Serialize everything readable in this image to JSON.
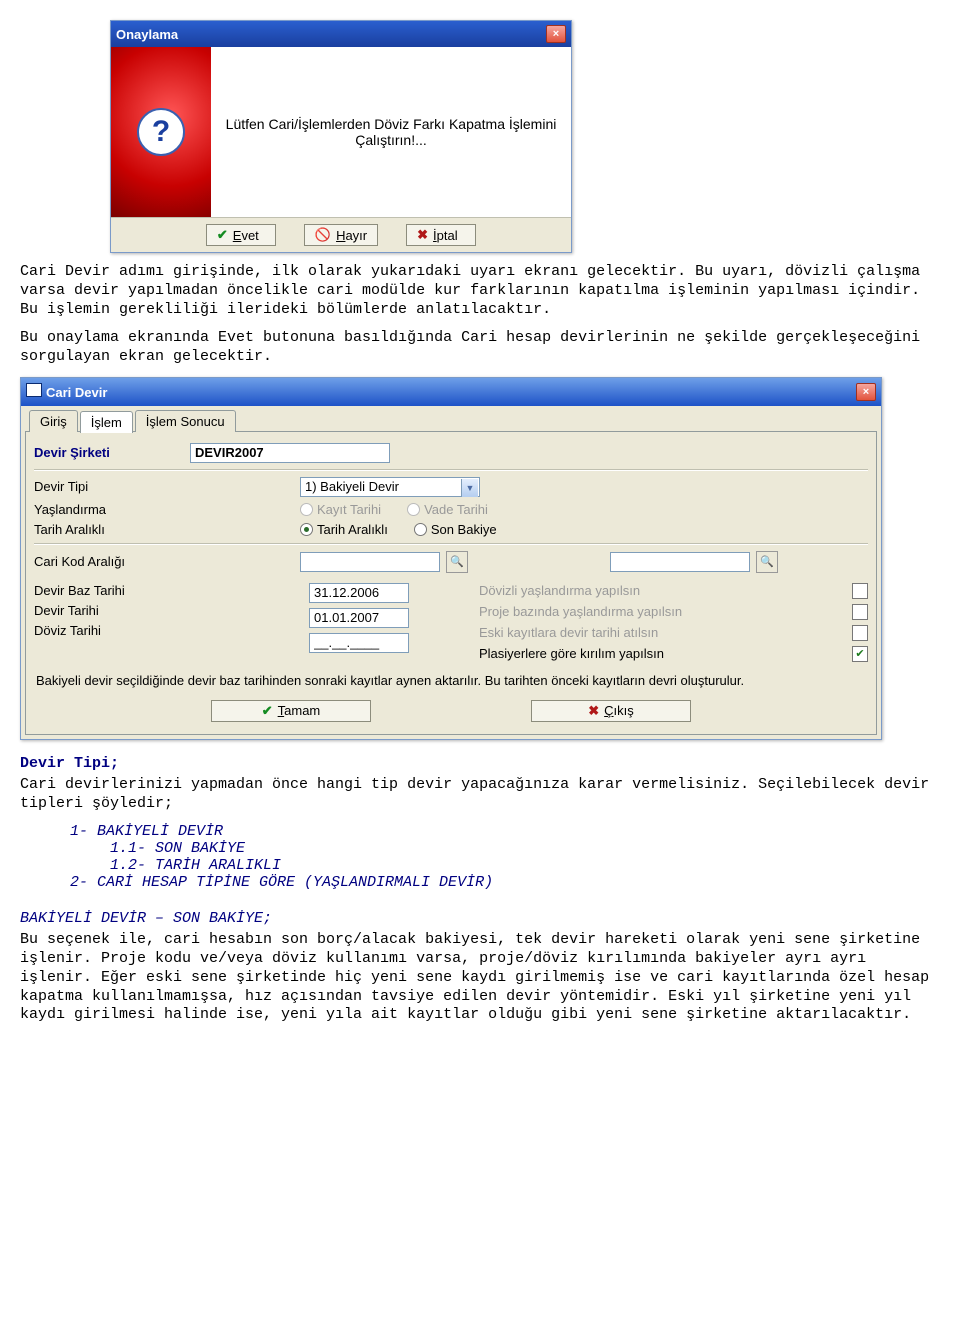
{
  "confirm": {
    "title": "Onaylama",
    "message": "Lütfen Cari/İşlemlerden Döviz Farkı Kapatma İşlemini Çalıştırın!...",
    "btn_yes": "Evet",
    "btn_no": "Hayır",
    "btn_cancel": "İptal"
  },
  "para1": "Cari Devir adımı girişinde, ilk olarak yukarıdaki uyarı ekranı gelecektir. Bu uyarı, dövizli çalışma varsa devir yapılmadan öncelikle cari modülde kur farklarının kapatılma işleminin yapılması içindir. Bu işlemin gerekliliği ilerideki bölümlerde anlatılacaktır.",
  "para2": "Bu onaylama ekranında Evet butonuna basıldığında Cari hesap devirlerinin ne şekilde gerçekleşeceğini sorgulayan ekran gelecektir.",
  "devir": {
    "title": "Cari Devir",
    "tabs": {
      "t1": "Giriş",
      "t2": "İşlem",
      "t3": "İşlem Sonucu"
    },
    "sirketi_label": "Devir Şirketi",
    "sirketi_value": "DEVIR2007",
    "tip_label": "Devir Tipi",
    "tip_value": "1) Bakiyeli Devir",
    "yas_label": "Yaşlandırma",
    "yas_r1": "Kayıt Tarihi",
    "yas_r2": "Vade Tarihi",
    "aralik_label": "Tarih Aralıklı",
    "aralik_r1": "Tarih Aralıklı",
    "aralik_r2": "Son Bakiye",
    "kod_label": "Cari Kod Aralığı",
    "baz_label": "Devir Baz Tarihi",
    "baz_value": "31.12.2006",
    "devir_tarih_label": "Devir Tarihi",
    "devir_tarih_value": "01.01.2007",
    "doviz_label": "Döviz Tarihi",
    "doviz_value": "__.__.____",
    "opt1": "Dövizli yaşlandırma yapılsın",
    "opt2": "Proje bazında yaşlandırma yapılsın",
    "opt3": "Eski kayıtlara devir tarihi atılsın",
    "opt4": "Plasiyerlere göre kırılım yapılsın",
    "note": "Bakiyeli devir seçildiğinde devir baz tarihinden sonraki kayıtlar aynen aktarılır. Bu tarihten önceki kayıtların devri oluşturulur.",
    "btn_ok": "Tamam",
    "btn_exit": "Çıkış"
  },
  "sec2": {
    "heading": "Devir Tipi;",
    "p": "Cari devirlerinizi yapmadan önce hangi tip devir yapacağınıza karar vermelisiniz. Seçilebilecek devir tipleri şöyledir;",
    "l1": "1- BAKİYELİ DEVİR",
    "l11": "1.1- SON BAKİYE",
    "l12": "1.2- TARİH ARALIKLI",
    "l2": "2- CARİ HESAP TİPİNE GÖRE (YAŞLANDIRMALI DEVİR)"
  },
  "sec3": {
    "heading": "BAKİYELİ DEVİR – SON BAKİYE;",
    "p": "Bu seçenek ile, cari hesabın son borç/alacak bakiyesi, tek devir hareketi olarak yeni sene şirketine işlenir. Proje kodu ve/veya döviz kullanımı varsa, proje/döviz kırılımında bakiyeler ayrı ayrı işlenir. Eğer eski sene şirketinde hiç yeni sene kaydı girilmemiş ise ve cari kayıtlarında özel hesap kapatma kullanılmamışsa, hız açısından tavsiye edilen devir yöntemidir. Eski yıl şirketine yeni yıl kaydı girilmesi halinde ise, yeni yıla ait kayıtlar olduğu gibi yeni sene şirketine aktarılacaktır."
  }
}
